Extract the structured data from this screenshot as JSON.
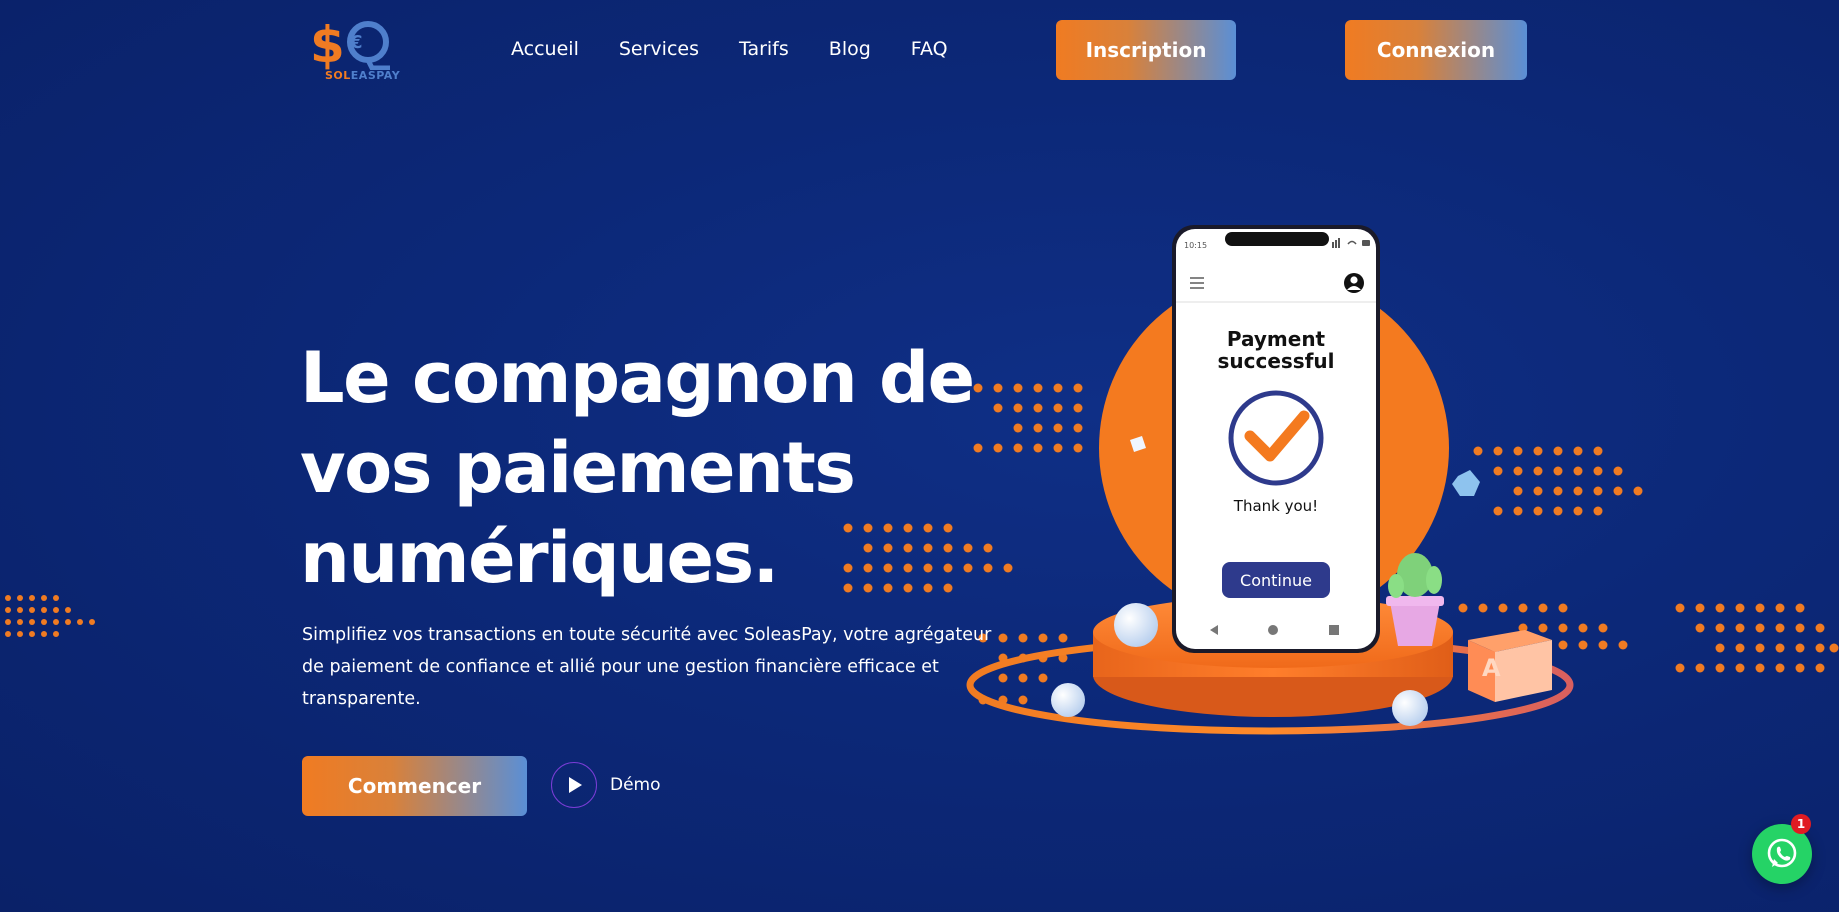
{
  "brand": {
    "logo_text_sol": "SOL",
    "logo_text_eas": "EAS",
    "logo_text_pay": "PAY",
    "primary": "#f07b22",
    "secondary": "#4f7fcc"
  },
  "nav": {
    "items": [
      "Accueil",
      "Services",
      "Tarifs",
      "Blog",
      "FAQ"
    ],
    "signup_label": "Inscription",
    "login_label": "Connexion"
  },
  "hero": {
    "title_line1": "Le compagnon de",
    "title_line2": "vos paiements",
    "title_line3": "numériques.",
    "subtitle": "Simplifiez vos transactions en toute sécurité avec SoleasPay, votre agrégateur de paiement de confiance et allié pour une gestion financière efficace et transparente.",
    "cta_label": "Commencer",
    "demo_label": "Démo"
  },
  "phone": {
    "time": "10:15",
    "heading_line1": "Payment",
    "heading_line2": "successful",
    "thanks": "Thank you!",
    "continue_label": "Continue"
  },
  "illustration": {
    "cube_letter": "A"
  },
  "whatsapp": {
    "badge_count": "1",
    "color": "#25d366"
  },
  "colors": {
    "background": "#0c2878",
    "accent_orange": "#f47a1f",
    "phone_button": "#2e3a8c"
  }
}
